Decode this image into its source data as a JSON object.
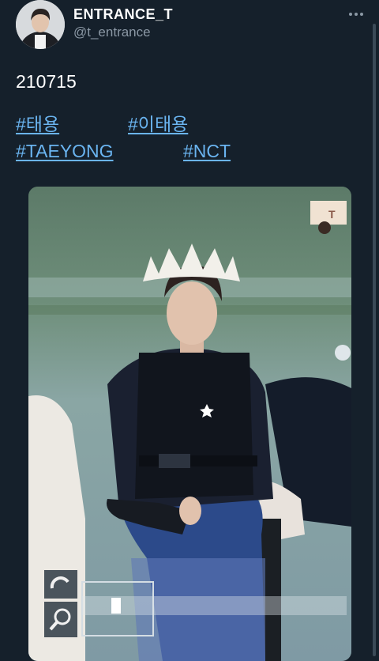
{
  "tweet": {
    "display_name": "ENTRANCE_T",
    "handle": "@t_entrance",
    "text": "210715",
    "hashtags": [
      "#태용",
      "#이태용",
      "#TAEYONG",
      "#NCT"
    ],
    "media": {
      "watermark": "T",
      "camera_icons": [
        "exposure-icon",
        "magnifier-icon"
      ]
    }
  },
  "colors": {
    "background": "#15202b",
    "link": "#6ab4f0",
    "secondary_text": "#8b98a5"
  }
}
